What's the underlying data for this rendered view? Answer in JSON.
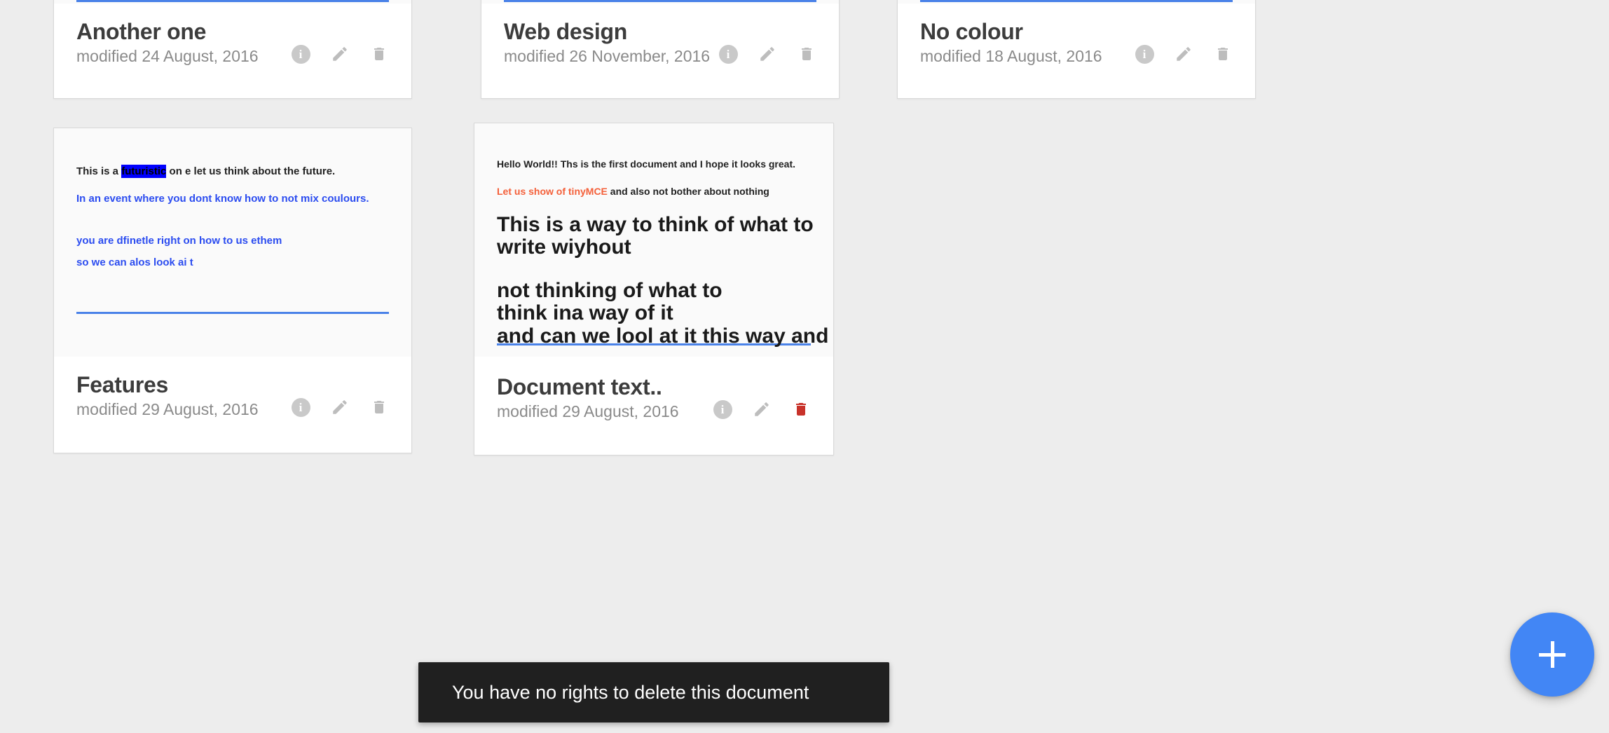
{
  "theme": {
    "page_bg": "#ededed",
    "card_bg": "#ffffff",
    "preview_bg": "#fafafa",
    "accent_blue": "#4286f5",
    "rule_blue": "#4a82e8",
    "title_color": "#3c3c3c",
    "subtitle_color": "#8a8a8a",
    "icon_gray": "#c0c0c0",
    "danger_red": "#c8322a",
    "highlight_blue": "#0000ff",
    "text_blue": "#2b4cf0",
    "text_orange": "#f4603a",
    "snackbar_bg": "#202020"
  },
  "cards": [
    {
      "id": "another-one",
      "title": "Another one",
      "modified": "modified 24 August, 2016",
      "preview_clipped_top": true,
      "delete_active": false,
      "actions": {
        "info_label": "i",
        "info_name": "info-icon",
        "edit_name": "pencil-icon",
        "delete_name": "trash-icon"
      }
    },
    {
      "id": "web-design",
      "title": "Web design",
      "modified": "modified 26 November, 2016",
      "preview_clipped_top": true,
      "delete_active": false,
      "actions": {
        "info_label": "i",
        "info_name": "info-icon",
        "edit_name": "pencil-icon",
        "delete_name": "trash-icon"
      }
    },
    {
      "id": "no-colour",
      "title": "No colour",
      "modified": "modified 18 August, 2016",
      "preview_clipped_top": true,
      "delete_active": false,
      "actions": {
        "info_label": "i",
        "info_name": "info-icon",
        "edit_name": "pencil-icon",
        "delete_name": "trash-icon"
      }
    },
    {
      "id": "features",
      "title": "Features",
      "modified": "modified 29 August, 2016",
      "preview_clipped_top": false,
      "delete_active": false,
      "actions": {
        "info_label": "i",
        "info_name": "info-icon",
        "edit_name": "pencil-icon",
        "delete_name": "trash-icon"
      },
      "preview": {
        "line1_a": "This is a ",
        "line1_highlight": "futuristic",
        "line1_b": " on e   let us think about the future.",
        "line2": "In an event where you dont know how to not mix coulours.",
        "line3": "you are dfinetle right on how to us ethem",
        "line4": "so we can alos look ai t"
      }
    },
    {
      "id": "document-text",
      "title": "Document text..",
      "modified": "modified 29 August, 2016",
      "preview_clipped_top": false,
      "delete_active": true,
      "actions": {
        "info_label": "i",
        "info_name": "info-icon",
        "edit_name": "pencil-icon",
        "delete_name": "trash-icon"
      },
      "preview": {
        "line1": "Hello World!! Ths is the first document and I hope it looks great.",
        "line2_orange": "Let us show of tinyMCE",
        "line2_rest": " and also not bother about nothing",
        "heading_line1": "This is a way to think of what to",
        "heading_line2": "write wiyhout",
        "heading_line3": "not thinking of what to",
        "heading_line4": "think ina way of it",
        "heading_line5": "and can we lool at it this way and"
      }
    }
  ],
  "fab": {
    "name": "add-document-fab",
    "label": "+"
  },
  "snackbar": {
    "message": "You have no rights to delete this document"
  }
}
